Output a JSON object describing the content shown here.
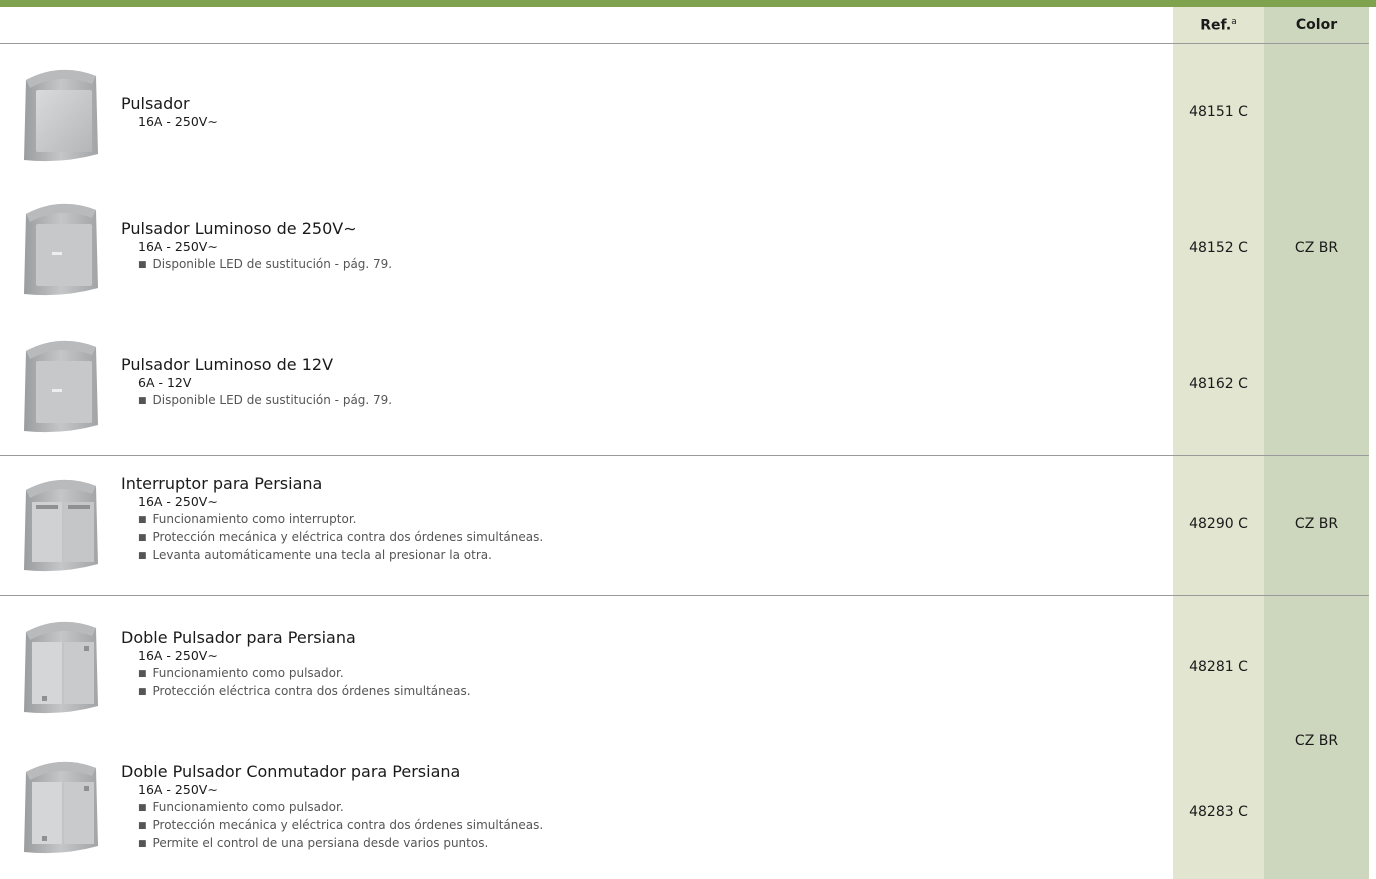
{
  "header": {
    "ref": "Ref.",
    "ref_sup": "a",
    "color": "Color"
  },
  "products": [
    {
      "title": "Pulsador",
      "spec": "16A - 250V∼",
      "bullets": [],
      "ref": "48151 C"
    },
    {
      "title": "Pulsador Luminoso de 250V∼",
      "spec": "16A - 250V∼",
      "bullets": [
        "Disponible LED de sustitución - pág. 79."
      ],
      "ref": "48152 C"
    },
    {
      "title": "Pulsador Luminoso de 12V",
      "spec": "6A - 12V",
      "bullets": [
        "Disponible LED de sustitución - pág. 79."
      ],
      "ref": "48162 C"
    },
    {
      "title": "Interruptor para Persiana",
      "spec": "16A - 250V∼",
      "bullets": [
        "Funcionamiento como interruptor.",
        "Protección mecánica y eléctrica contra dos órdenes simultáneas.",
        "Levanta automáticamente una tecla al presionar la otra."
      ],
      "ref": "48290 C"
    },
    {
      "title": "Doble Pulsador para Persiana",
      "spec": "16A - 250V∼",
      "bullets": [
        "Funcionamiento como pulsador.",
        "Protección eléctrica contra dos órdenes simultáneas."
      ],
      "ref": "48281 C"
    },
    {
      "title": "Doble Pulsador Conmutador para Persiana",
      "spec": "16A - 250V∼",
      "bullets": [
        "Funcionamiento como pulsador.",
        "Protección mecánica y eléctrica contra dos órdenes simultáneas.",
        "Permite el control de una persiana desde varios puntos."
      ],
      "ref": "48283 C"
    }
  ],
  "colors": [
    "CZ BR",
    "CZ BR",
    "CZ BR"
  ],
  "theme": {
    "accent": "#7fa24e",
    "ref_column": "#e2e5d0",
    "color_column": "#ccd7bd"
  }
}
